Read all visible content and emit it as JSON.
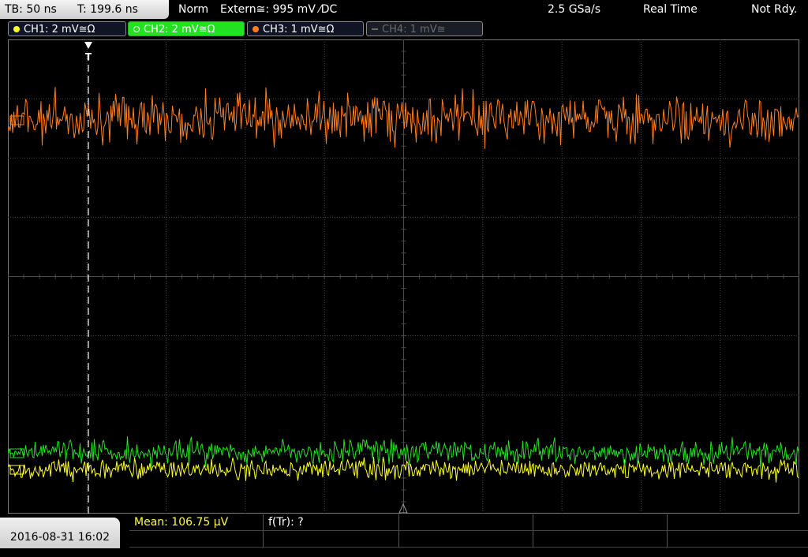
{
  "topbar": {
    "timebase": "TB: 50 ns",
    "trigger_time": "T: 199.6 ns",
    "trigger_mode": "Norm",
    "trigger_source": "Extern≅: 995 mV ⁄DC",
    "sample_rate": "2.5 GSa/s",
    "acq_mode": "Real Time",
    "status": "Not Rdy."
  },
  "channels": [
    {
      "label": "CH1: 2 mV≅Ω",
      "color": "#ffff2a",
      "active": true
    },
    {
      "label": "CH2: 2 mV≅Ω",
      "color": "#22e022",
      "active": true
    },
    {
      "label": "CH3: 1 mV≅Ω",
      "color": "#ff7f20",
      "active": true
    },
    {
      "label": "CH4: 1 mV≅",
      "color": "#6a6a6a",
      "active": false
    }
  ],
  "trigger_marker": "T",
  "datetime": "2016-08-31 16:02",
  "measurements": {
    "mean": "Mean: 106.75 µV",
    "ftr": "f(Tr): ?"
  },
  "colors": {
    "ch1": "#ffff2a",
    "ch2": "#22e022",
    "ch3": "#ff7f20",
    "grid": "#4a4a4a",
    "background": "#000000"
  }
}
